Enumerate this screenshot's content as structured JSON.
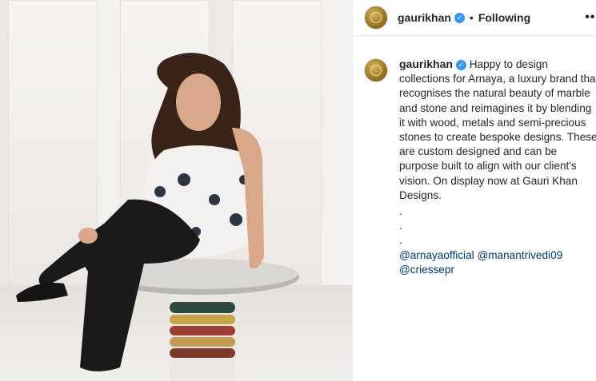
{
  "header": {
    "username": "gaurikhan",
    "separator": "•",
    "follow_status": "Following",
    "more": "•••"
  },
  "caption": {
    "username": "gaurikhan",
    "text": "Happy to design collections for Arnaya, a luxury brand that recognises the natural beauty of marble and stone and reimagines it by blending it with wood, metals and semi-precious stones to create bespoke designs. These are custom designed and can be purpose built to align with our client's vision. On display now at Gauri Khan Designs.",
    "dots": [
      ".",
      ".",
      "."
    ],
    "mentions": [
      "@arnayaofficial",
      "@manantrivedi09",
      "@criessepr"
    ]
  },
  "colors": {
    "verified": "#3897f0",
    "mention": "#00376b",
    "text": "#262626"
  },
  "icons": {
    "verified": "verified-badge-icon",
    "more": "more-options-icon"
  }
}
